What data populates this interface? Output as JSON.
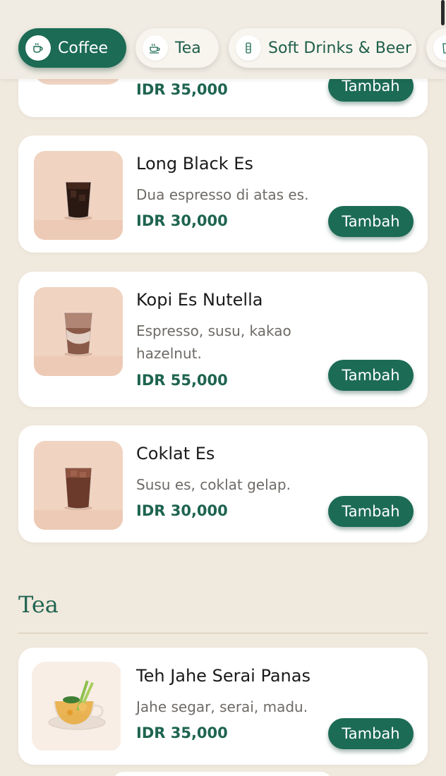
{
  "categories": [
    {
      "label": "Coffee",
      "icon": "coffee-cup-icon",
      "active": true
    },
    {
      "label": "Tea",
      "icon": "tea-cup-icon",
      "active": false
    },
    {
      "label": "Soft Drinks & Beer",
      "icon": "bottle-icon",
      "active": false
    },
    {
      "label": "",
      "icon": "glass-icon",
      "active": false
    }
  ],
  "coffee_items": [
    {
      "name": "",
      "description": "",
      "price": "IDR 35,000",
      "button": "Tambah",
      "drink": "partial"
    },
    {
      "name": "Long Black Es",
      "description": "Dua espresso di atas es.",
      "price": "IDR 30,000",
      "button": "Tambah",
      "drink": "long-black"
    },
    {
      "name": "Kopi Es Nutella",
      "description": "Espresso, susu, kakao hazelnut.",
      "price": "IDR 55,000",
      "button": "Tambah",
      "drink": "nutella"
    },
    {
      "name": "Coklat Es",
      "description": "Susu es, coklat gelap.",
      "price": "IDR 30,000",
      "button": "Tambah",
      "drink": "chocolate"
    }
  ],
  "tea_section": {
    "title": "Tea",
    "items": [
      {
        "name": "Teh Jahe Serai Panas",
        "description": "Jahe segar, serai, madu.",
        "price": "IDR 35,000",
        "button": "Tambah",
        "drink": "ginger-tea"
      }
    ]
  },
  "colors": {
    "accent": "#1c6b55",
    "price": "#1e6450",
    "background": "#f0e9dd",
    "card": "#ffffff",
    "thumb_bg": "#f1d4c3"
  }
}
